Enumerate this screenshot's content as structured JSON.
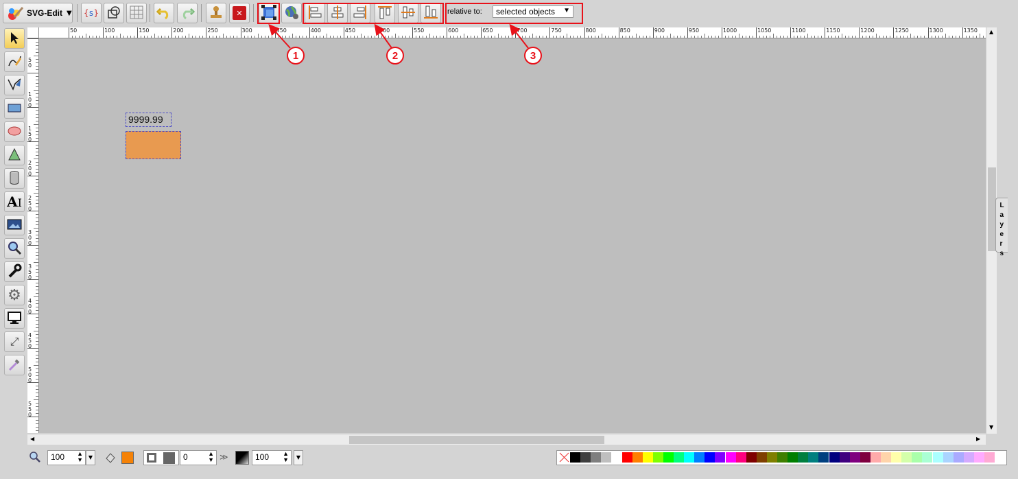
{
  "app": {
    "menu_label": "SVG-Edit"
  },
  "align": {
    "relative_label": "relative to:",
    "relative_value": "selected objects"
  },
  "canvas": {
    "text_element": "9999.99",
    "rect_color": "#e89a50"
  },
  "layers_label": "Layers",
  "ruler": {
    "h_ticks": [
      "50",
      "100",
      "150",
      "200",
      "250",
      "300",
      "350",
      "400",
      "450",
      "500",
      "550",
      "600",
      "650",
      "700",
      "750",
      "800",
      "850",
      "900",
      "950",
      "1000",
      "1050",
      "1100",
      "1150",
      "1200",
      "1250",
      "1300",
      "1350"
    ],
    "v_ticks": [
      "50",
      "100",
      "150",
      "200",
      "250",
      "300",
      "350",
      "400",
      "450",
      "500",
      "550"
    ]
  },
  "bottom": {
    "zoom": "100",
    "stroke_width": "0",
    "opacity": "100",
    "fill_color": "#f58207"
  },
  "callouts": [
    "1",
    "2",
    "3"
  ],
  "palette": [
    "#000000",
    "#3f3f3f",
    "#7f7f7f",
    "#bfbfbf",
    "#ffffff",
    "#ff0000",
    "#ff7f00",
    "#ffff00",
    "#7fff00",
    "#00ff00",
    "#00ff7f",
    "#00ffff",
    "#007fff",
    "#0000ff",
    "#7f00ff",
    "#ff00ff",
    "#ff007f",
    "#7f0000",
    "#7f3f00",
    "#7f7f00",
    "#3f7f00",
    "#007f00",
    "#007f3f",
    "#007f7f",
    "#003f7f",
    "#00007f",
    "#3f007f",
    "#7f007f",
    "#7f003f",
    "#ffaaaa",
    "#ffd4aa",
    "#ffffaa",
    "#d4ffaa",
    "#aaffaa",
    "#aaffd4",
    "#aaffff",
    "#aad4ff",
    "#aaaaff",
    "#d4aaff",
    "#ffaaff",
    "#ffaad4"
  ]
}
